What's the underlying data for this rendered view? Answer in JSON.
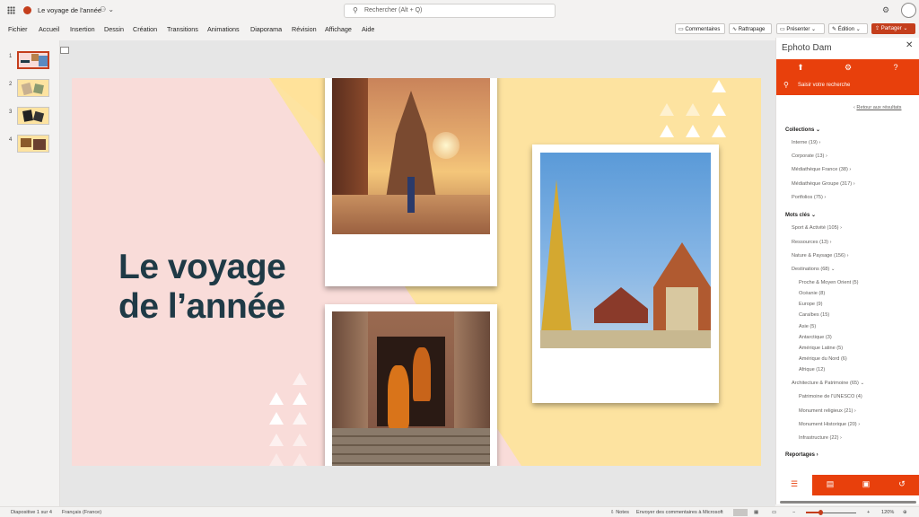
{
  "app": {
    "title": "Le voyage de l'année",
    "search_placeholder": "Rechercher (Alt + Q)"
  },
  "menu": [
    "Fichier",
    "Accueil",
    "Insertion",
    "Dessin",
    "Création",
    "Transitions",
    "Animations",
    "Diaporama",
    "Révision",
    "Affichage",
    "Aide"
  ],
  "toolbar": {
    "comments": "Commentaires",
    "catchup": "Rattrapage",
    "present": "Présenter",
    "edit": "Édition",
    "share": "Partager"
  },
  "thumbs": [
    "1",
    "2",
    "3",
    "4"
  ],
  "slide": {
    "title_line1": "Le voyage",
    "title_line2": "de l’année"
  },
  "panel": {
    "title": "Ephoto Dam",
    "search_placeholder": "Saisir votre recherche",
    "back": "Retour aux résultats",
    "collections_header": "Collections",
    "collections": [
      "Interne (19)",
      "Corporate (13)",
      "Médiathèque France (38)",
      "Médiathèque Groupe (317)",
      "Portfolios (75)"
    ],
    "keywords_header": "Mots clés",
    "keywords": [
      "Sport & Activité (105)",
      "Ressources (13)",
      "Nature & Paysage (156)",
      "Destinations (68)"
    ],
    "destinations": [
      "Proche & Moyen Orient (5)",
      "Océanie (8)",
      "Europe (9)",
      "Caraïbes (15)",
      "Asie (5)",
      "Antarctique (3)",
      "Amérique Latine (5)",
      "Amérique du Nord (6)",
      "Afrique (12)"
    ],
    "architecture": "Architecture & Patrimoine (65)",
    "architecture_items": [
      "Patrimoine de l'UNESCO (4)",
      "Monument religieux (21)",
      "Monument Historique (20)",
      "Infrastructure (22)"
    ],
    "reportages": "Reportages"
  },
  "status": {
    "slide_of": "Diapositive 1 sur 4",
    "language": "Français (France)",
    "notes": "Notes",
    "feedback": "Envoyer des commentaires à Microsoft",
    "zoom": "120%"
  },
  "colors": {
    "accent": "#c43e1c",
    "panel_orange": "#e8400c",
    "title": "#1f3a46"
  }
}
